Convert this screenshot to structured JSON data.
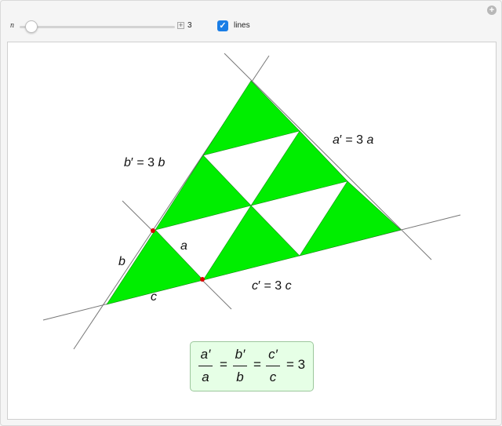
{
  "controls": {
    "n_label": "n",
    "n_value": "3",
    "lines_label": "lines",
    "lines_checked": true
  },
  "diagram": {
    "colors": {
      "fill": "#00ee00",
      "edge": "#1a8a1a",
      "line": "#777777",
      "point": "#dd0000"
    },
    "labels": {
      "a_prime": {
        "letter": "a",
        "rhs": "= 3",
        "var": "a"
      },
      "b_prime": {
        "letter": "b",
        "rhs": "= 3",
        "var": "b"
      },
      "c_prime": {
        "letter": "c",
        "rhs": "= 3",
        "var": "c"
      },
      "a": "a",
      "b": "b",
      "c": "c"
    }
  },
  "formula": {
    "num1": "a′",
    "den1": "a",
    "num2": "b′",
    "den2": "b",
    "num3": "c′",
    "den3": "c",
    "eq": "=",
    "result": "= 3"
  }
}
